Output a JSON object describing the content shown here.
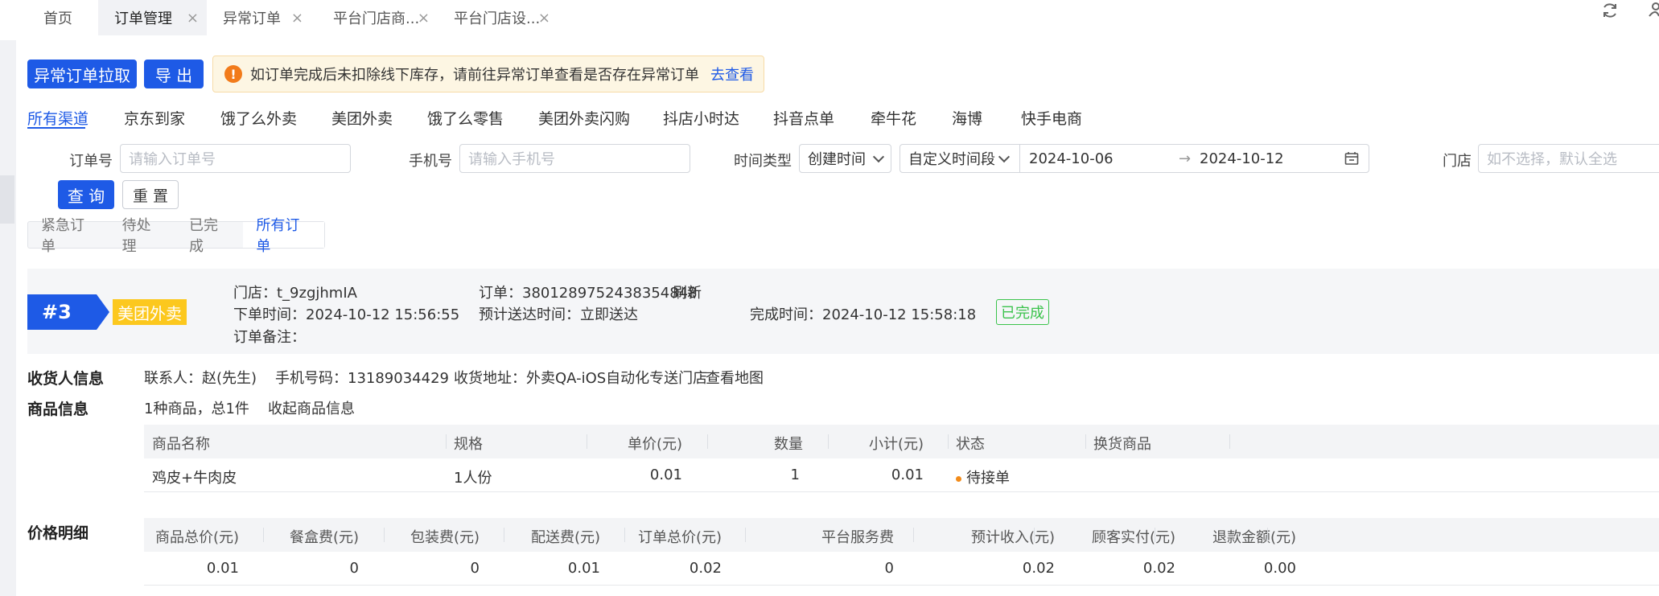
{
  "tabs": [
    {
      "label": "首页",
      "closable": false,
      "active": false
    },
    {
      "label": "订单管理",
      "closable": true,
      "active": true
    },
    {
      "label": "异常订单",
      "closable": true,
      "active": false
    },
    {
      "label": "平台门店商...",
      "closable": true,
      "active": false
    },
    {
      "label": "平台门店设...",
      "closable": true,
      "active": false
    }
  ],
  "tab_close_glyph": "×",
  "actions": {
    "pull_label": "异常订单拉取",
    "export_label": "导 出"
  },
  "notice": {
    "icon": "!",
    "text": "如订单完成后未扣除线下库存，请前往异常订单查看是否存在异常订单",
    "link": "去查看"
  },
  "channels": [
    "所有渠道",
    "京东到家",
    "饿了么外卖",
    "美团外卖",
    "饿了么零售",
    "美团外卖闪购",
    "抖店小时达",
    "抖音点单",
    "牵牛花",
    "海博",
    "快手电商"
  ],
  "filters": {
    "order_no_label": "订单号",
    "order_no_placeholder": "请输入订单号",
    "phone_label": "手机号",
    "phone_placeholder": "请输入手机号",
    "time_type_label": "时间类型",
    "time_type_value": "创建时间",
    "range_type_value": "自定义时间段",
    "date_start": "2024-10-06",
    "date_end": "2024-10-12",
    "range_arrow": "→",
    "store_label": "门店",
    "store_placeholder": "如不选择，默认全选",
    "query_label": "查 询",
    "reset_label": "重 置"
  },
  "status_tabs": [
    "紧急订单",
    "待处理",
    "已完成",
    "所有订单"
  ],
  "order": {
    "seq": "#3",
    "platform": "美团外卖",
    "store": "门店：t_9zgjhmIA",
    "order_no": "订单：3801289752438354848",
    "refresh": "刷新",
    "placed_time": "下单时间：2024-10-12 15:56:55",
    "eta": "预计送达时间：立即送达",
    "finish_time": "完成时间：2024-10-12 15:58:18",
    "status": "已完成",
    "remark": "订单备注："
  },
  "receiver": {
    "title": "收货人信息",
    "contact": "联系人：赵(先生)",
    "phone": "手机号码：13189034429",
    "address": "收货地址：外卖QA-iOS自动化专送门店",
    "map_link": "查看地图"
  },
  "goods": {
    "title": "商品信息",
    "summary": "1种商品，总1件",
    "collapse": "收起商品信息",
    "headers": [
      "商品名称",
      "规格",
      "单价(元)",
      "数量",
      "小计(元)",
      "状态",
      "换货商品"
    ],
    "rows": [
      {
        "name": "鸡皮+牛肉皮",
        "spec": "1人份",
        "price": "0.01",
        "qty": "1",
        "subtotal": "0.01",
        "status": "待接单",
        "swap": ""
      }
    ],
    "status_color": "#f28b1a"
  },
  "price": {
    "title": "价格明细",
    "headers": [
      "商品总价(元)",
      "餐盒费(元)",
      "包装费(元)",
      "配送费(元)",
      "订单总价(元)",
      "平台服务费",
      "预计收入(元)",
      "顾客实付(元)",
      "退款金额(元)"
    ],
    "values": [
      "0.01",
      "0",
      "0",
      "0.01",
      "0.02",
      "0",
      "0.02",
      "0.02",
      "0.00"
    ]
  },
  "colors": {
    "primary": "#1e5ae6",
    "meituan": "#fcc81e",
    "done": "#3bc34c",
    "warn": "#f27b1a"
  },
  "icons": {
    "refresh": "refresh-icon",
    "user": "user-icon",
    "calendar": "calendar-icon",
    "warning": "warning-icon",
    "chevron": "chevron-down-icon"
  }
}
